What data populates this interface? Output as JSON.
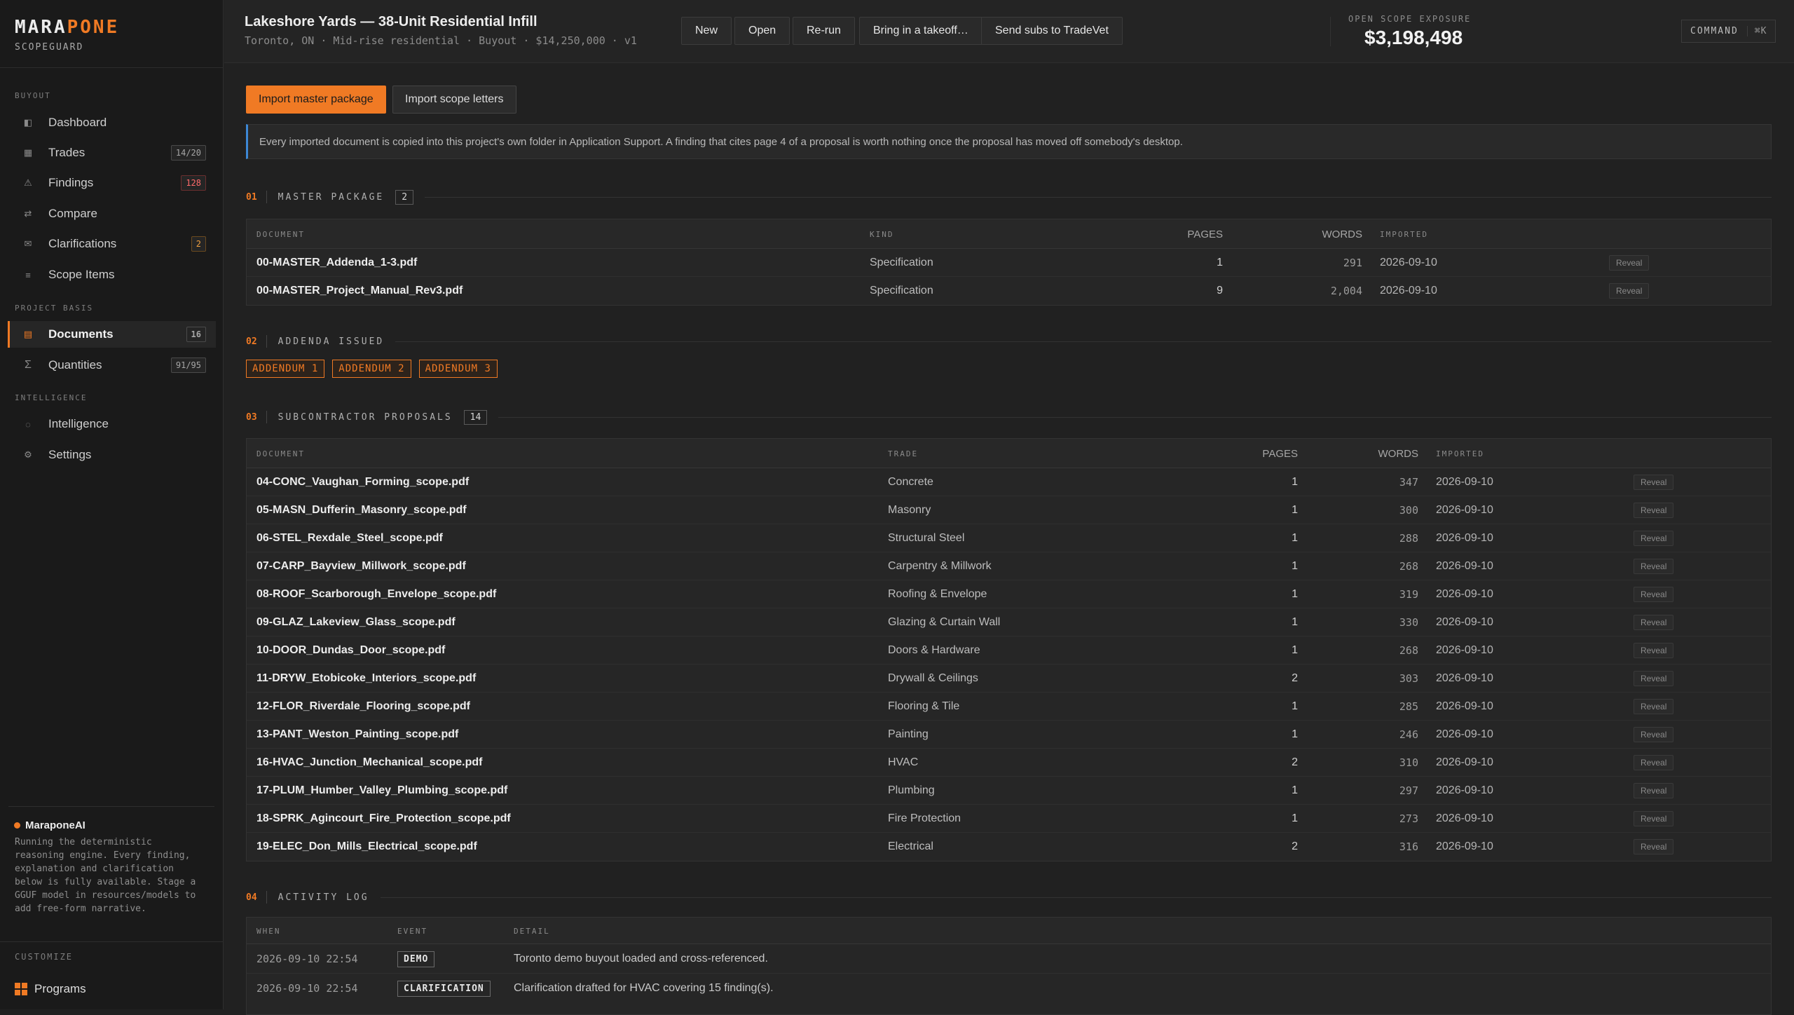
{
  "brand": {
    "name_a": "MARA",
    "name_b": "PONE",
    "sub": "SCOPEGUARD",
    "accent": "#f07a24"
  },
  "nav": {
    "sections": [
      "BUYOUT",
      "PROJECT BASIS",
      "INTELLIGENCE"
    ],
    "items": [
      {
        "label": "Dashboard",
        "icon": "dashboard-icon",
        "badge": ""
      },
      {
        "label": "Trades",
        "icon": "trades-icon",
        "badge": "14/20"
      },
      {
        "label": "Findings",
        "icon": "warning-icon",
        "badge": "128"
      },
      {
        "label": "Compare",
        "icon": "compare-icon",
        "badge": ""
      },
      {
        "label": "Clarifications",
        "icon": "mail-icon",
        "badge": "2"
      },
      {
        "label": "Scope Items",
        "icon": "list-icon",
        "badge": ""
      },
      {
        "label": "Documents",
        "icon": "document-icon",
        "badge": "16"
      },
      {
        "label": "Quantities",
        "icon": "sigma-icon",
        "badge": "91/95"
      },
      {
        "label": "Intelligence",
        "icon": "intelligence-icon",
        "badge": ""
      },
      {
        "label": "Settings",
        "icon": "gear-icon",
        "badge": ""
      }
    ]
  },
  "ai": {
    "title": "MaraponeAI",
    "text": "Running the deterministic\nreasoning engine. Every finding,\nexplanation and clarification\nbelow is fully available. Stage a\nGGUF model in resources/models to\nadd free-form narrative."
  },
  "customize": {
    "label": "CUSTOMIZE",
    "programs": "Programs"
  },
  "header": {
    "title": "Lakeshore Yards — 38-Unit Residential Infill",
    "subtitle": "Toronto, ON · Mid-rise residential · Buyout · $14,250,000 · v1",
    "buttons": [
      "New",
      "Open",
      "Re-run",
      "Bring in a takeoff…",
      "Send subs to TradeVet"
    ],
    "exposure_label": "OPEN SCOPE EXPOSURE",
    "exposure_value": "$3,198,498",
    "command_label": "COMMAND",
    "command_kbd": "⌘K"
  },
  "main": {
    "import_master": "Import master package",
    "import_letters": "Import scope letters",
    "notice": "Every imported document is copied into this project's own folder in Application Support. A finding that cites page 4 of a proposal is worth nothing once the proposal has moved off somebody's desktop."
  },
  "master": {
    "num": "01",
    "title": "MASTER PACKAGE",
    "count": "2",
    "columns": [
      "DOCUMENT",
      "KIND",
      "PAGES",
      "WORDS",
      "IMPORTED"
    ],
    "rows": [
      {
        "doc": "00-MASTER_Addenda_1-3.pdf",
        "kind": "Specification",
        "pages": "1",
        "words": "291",
        "date": "2026-09-10",
        "action": "Reveal"
      },
      {
        "doc": "00-MASTER_Project_Manual_Rev3.pdf",
        "kind": "Specification",
        "pages": "9",
        "words": "2,004",
        "date": "2026-09-10",
        "action": "Reveal"
      }
    ]
  },
  "addenda": {
    "num": "02",
    "title": "ADDENDA ISSUED",
    "items": [
      "ADDENDUM 1",
      "ADDENDUM 2",
      "ADDENDUM 3"
    ]
  },
  "proposals": {
    "num": "03",
    "title": "SUBCONTRACTOR PROPOSALS",
    "count": "14",
    "columns": [
      "DOCUMENT",
      "TRADE",
      "PAGES",
      "WORDS",
      "IMPORTED"
    ],
    "rows": [
      {
        "doc": "04-CONC_Vaughan_Forming_scope.pdf",
        "trade": "Concrete",
        "pages": "1",
        "words": "347",
        "date": "2026-09-10",
        "action": "Reveal"
      },
      {
        "doc": "05-MASN_Dufferin_Masonry_scope.pdf",
        "trade": "Masonry",
        "pages": "1",
        "words": "300",
        "date": "2026-09-10",
        "action": "Reveal"
      },
      {
        "doc": "06-STEL_Rexdale_Steel_scope.pdf",
        "trade": "Structural Steel",
        "pages": "1",
        "words": "288",
        "date": "2026-09-10",
        "action": "Reveal"
      },
      {
        "doc": "07-CARP_Bayview_Millwork_scope.pdf",
        "trade": "Carpentry & Millwork",
        "pages": "1",
        "words": "268",
        "date": "2026-09-10",
        "action": "Reveal"
      },
      {
        "doc": "08-ROOF_Scarborough_Envelope_scope.pdf",
        "trade": "Roofing & Envelope",
        "pages": "1",
        "words": "319",
        "date": "2026-09-10",
        "action": "Reveal"
      },
      {
        "doc": "09-GLAZ_Lakeview_Glass_scope.pdf",
        "trade": "Glazing & Curtain Wall",
        "pages": "1",
        "words": "330",
        "date": "2026-09-10",
        "action": "Reveal"
      },
      {
        "doc": "10-DOOR_Dundas_Door_scope.pdf",
        "trade": "Doors & Hardware",
        "pages": "1",
        "words": "268",
        "date": "2026-09-10",
        "action": "Reveal"
      },
      {
        "doc": "11-DRYW_Etobicoke_Interiors_scope.pdf",
        "trade": "Drywall & Ceilings",
        "pages": "2",
        "words": "303",
        "date": "2026-09-10",
        "action": "Reveal"
      },
      {
        "doc": "12-FLOR_Riverdale_Flooring_scope.pdf",
        "trade": "Flooring & Tile",
        "pages": "1",
        "words": "285",
        "date": "2026-09-10",
        "action": "Reveal"
      },
      {
        "doc": "13-PANT_Weston_Painting_scope.pdf",
        "trade": "Painting",
        "pages": "1",
        "words": "246",
        "date": "2026-09-10",
        "action": "Reveal"
      },
      {
        "doc": "16-HVAC_Junction_Mechanical_scope.pdf",
        "trade": "HVAC",
        "pages": "2",
        "words": "310",
        "date": "2026-09-10",
        "action": "Reveal"
      },
      {
        "doc": "17-PLUM_Humber_Valley_Plumbing_scope.pdf",
        "trade": "Plumbing",
        "pages": "1",
        "words": "297",
        "date": "2026-09-10",
        "action": "Reveal"
      },
      {
        "doc": "18-SPRK_Agincourt_Fire_Protection_scope.pdf",
        "trade": "Fire Protection",
        "pages": "1",
        "words": "273",
        "date": "2026-09-10",
        "action": "Reveal"
      },
      {
        "doc": "19-ELEC_Don_Mills_Electrical_scope.pdf",
        "trade": "Electrical",
        "pages": "2",
        "words": "316",
        "date": "2026-09-10",
        "action": "Reveal"
      }
    ]
  },
  "activity": {
    "num": "04",
    "title": "ACTIVITY LOG",
    "columns": [
      "WHEN",
      "EVENT",
      "DETAIL"
    ],
    "rows": [
      {
        "when": "2026-09-10 22:54",
        "event": "DEMO",
        "detail": "Toronto demo buyout loaded and cross-referenced."
      },
      {
        "when": "2026-09-10 22:54",
        "event": "CLARIFICATION",
        "detail": "Clarification drafted for HVAC covering 15 finding(s)."
      }
    ]
  }
}
